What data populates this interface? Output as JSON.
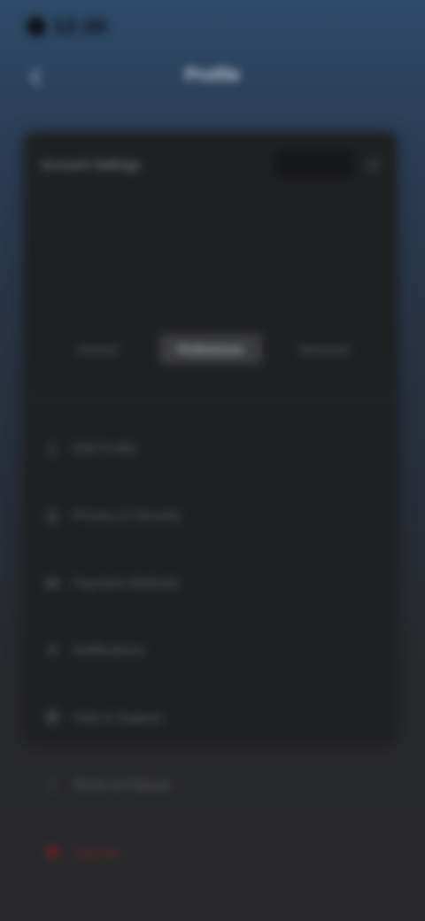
{
  "status": {
    "time": "12:30"
  },
  "header": {
    "title": "Profile"
  },
  "panel": {
    "header_title": "Account Settings"
  },
  "segments": [
    {
      "label": "General"
    },
    {
      "label": "Preferences"
    },
    {
      "label": "Advanced"
    }
  ],
  "menu": [
    {
      "label": "Edit Profile",
      "icon": "user-icon"
    },
    {
      "label": "Privacy & Security",
      "icon": "lock-icon"
    },
    {
      "label": "Payment Methods",
      "icon": "card-icon"
    },
    {
      "label": "Notifications",
      "icon": "bell-icon"
    },
    {
      "label": "Help & Support",
      "icon": "help-icon"
    },
    {
      "label": "Terms & Policies",
      "icon": "document-icon"
    },
    {
      "label": "Log Out",
      "icon": "logout-icon"
    }
  ],
  "colors": {
    "accent": "#3b3c3f",
    "danger": "#7a2525",
    "panel": "#1f2021"
  }
}
